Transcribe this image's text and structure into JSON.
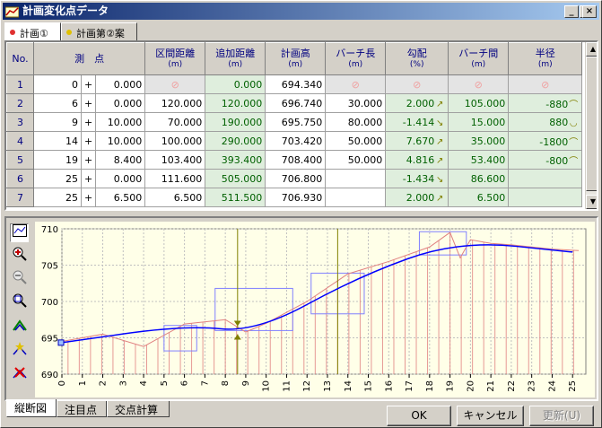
{
  "window": {
    "title": "計画変化点データ",
    "min": "_",
    "max": "□",
    "close": "×"
  },
  "top_tabs": [
    {
      "label": "計画①",
      "color": "#e03030"
    },
    {
      "label": "計画第②案",
      "color": "#e0c000"
    }
  ],
  "table": {
    "headers": {
      "no": "No.",
      "measure": "測　点",
      "section": "区間距離",
      "cumulative": "追加距離",
      "elevation": "計画高",
      "vcurve": "バーチ長",
      "grade": "勾配",
      "vcurve_interval": "バーチ間",
      "radius": "半径",
      "unit_m": "(m)",
      "unit_pct": "(%)"
    },
    "rows": [
      {
        "no": "1",
        "sta": "0",
        "plus": "+",
        "offset": "0.000",
        "section": "",
        "cumulative": "0.000",
        "elevation": "694.340",
        "vcurve": "",
        "grade": "",
        "arrow": "",
        "interval": "",
        "radius": "",
        "rarrow": ""
      },
      {
        "no": "2",
        "sta": "6",
        "plus": "+",
        "offset": "0.000",
        "section": "120.000",
        "cumulative": "120.000",
        "elevation": "696.740",
        "vcurve": "30.000",
        "grade": "2.000",
        "arrow": "↗",
        "interval": "105.000",
        "radius": "-880",
        "rarrow": "⌒"
      },
      {
        "no": "3",
        "sta": "9",
        "plus": "+",
        "offset": "10.000",
        "section": "70.000",
        "cumulative": "190.000",
        "elevation": "695.750",
        "vcurve": "80.000",
        "grade": "-1.414",
        "arrow": "↘",
        "interval": "15.000",
        "radius": "880",
        "rarrow": "◡"
      },
      {
        "no": "4",
        "sta": "14",
        "plus": "+",
        "offset": "10.000",
        "section": "100.000",
        "cumulative": "290.000",
        "elevation": "703.420",
        "vcurve": "50.000",
        "grade": "7.670",
        "arrow": "↗",
        "interval": "35.000",
        "radius": "-1800",
        "rarrow": "⌒"
      },
      {
        "no": "5",
        "sta": "19",
        "plus": "+",
        "offset": "8.400",
        "section": "103.400",
        "cumulative": "393.400",
        "elevation": "708.400",
        "vcurve": "50.000",
        "grade": "4.816",
        "arrow": "↗",
        "interval": "53.400",
        "radius": "-800",
        "rarrow": "⌒"
      },
      {
        "no": "6",
        "sta": "25",
        "plus": "+",
        "offset": "0.000",
        "section": "111.600",
        "cumulative": "505.000",
        "elevation": "706.800",
        "vcurve": "",
        "grade": "-1.434",
        "arrow": "↘",
        "interval": "86.600",
        "radius": "",
        "rarrow": ""
      },
      {
        "no": "7",
        "sta": "25",
        "plus": "+",
        "offset": "6.500",
        "section": "6.500",
        "cumulative": "511.500",
        "elevation": "706.930",
        "vcurve": "",
        "grade": "2.000",
        "arrow": "↗",
        "interval": "6.500",
        "radius": "",
        "rarrow": ""
      }
    ]
  },
  "chart_data": {
    "type": "line",
    "y_ticks": [
      "690",
      "695",
      "700",
      "705",
      "710"
    ],
    "ylim": [
      690,
      710
    ],
    "x_ticks": [
      "0",
      "1",
      "2",
      "3",
      "4",
      "5",
      "6",
      "7",
      "8",
      "9",
      "10",
      "11",
      "12",
      "13",
      "14",
      "15",
      "16",
      "17",
      "18",
      "19",
      "20",
      "21",
      "22",
      "23",
      "24",
      "25"
    ],
    "xlim": [
      0,
      25.65
    ],
    "plan_line": {
      "x": [
        0,
        6,
        9.5,
        14.5,
        19.42,
        25
      ],
      "y": [
        694.34,
        696.74,
        695.75,
        703.42,
        708.4,
        706.8
      ]
    },
    "ground_line": {
      "x": [
        0,
        2,
        4,
        6,
        8,
        9,
        10,
        12,
        14,
        16,
        18,
        19,
        19.5,
        20,
        21,
        22,
        24,
        25.3
      ],
      "y": [
        694.5,
        695.5,
        693.8,
        696.9,
        697.5,
        695.8,
        697.0,
        700.0,
        703.8,
        705.5,
        707.5,
        709.5,
        706.0,
        708.5,
        708.0,
        707.8,
        707.2,
        707.0
      ]
    },
    "colors": {
      "plan": "#0000ff",
      "ground": "#e08080",
      "bg": "#ffffe8",
      "grid": "#c0c0c0",
      "marker": "#808000"
    }
  },
  "tools": [
    "profile-view-icon",
    "zoom-in-icon",
    "zoom-out-icon",
    "zoom-fit-icon",
    "curve-up-icon",
    "curve-star-icon",
    "delete-point-icon"
  ],
  "bottom_tabs": [
    "縦断図",
    "注目点",
    "交点計算"
  ],
  "buttons": {
    "ok": "OK",
    "cancel": "キャンセル",
    "update": "更新(U)"
  }
}
